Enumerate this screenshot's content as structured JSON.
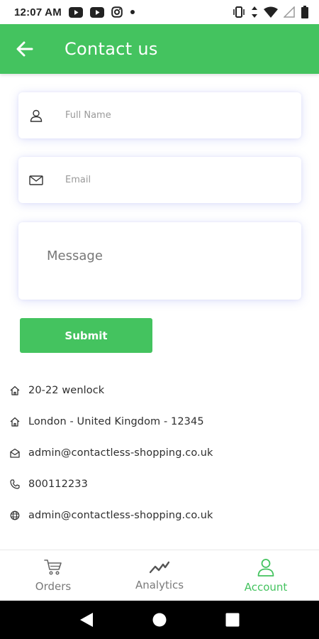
{
  "status_bar": {
    "time": "12:07 AM",
    "left_icons": [
      "youtube-icon",
      "youtube-icon",
      "instagram-icon",
      "dot-icon"
    ],
    "right_icons": [
      "vibrate-icon",
      "data-arrows-icon",
      "wifi-icon",
      "signal-icon",
      "battery-icon"
    ]
  },
  "header": {
    "title": "Contact us",
    "back_icon": "arrow-left-icon",
    "color": "#44c35f"
  },
  "form": {
    "full_name": {
      "placeholder": "Full Name",
      "value": "",
      "icon": "person-icon"
    },
    "email": {
      "placeholder": "Email",
      "value": "",
      "icon": "mail-icon"
    },
    "message": {
      "placeholder": "Message",
      "value": ""
    },
    "submit_label": "Submit"
  },
  "contact_info": {
    "address_line1": {
      "icon": "home-icon",
      "text": "20-22 wenlock"
    },
    "address_line2": {
      "icon": "home-icon",
      "text": "London - United Kingdom - 12345"
    },
    "email": {
      "icon": "mail-open-icon",
      "text": "admin@contactless-shopping.co.uk"
    },
    "phone": {
      "icon": "phone-icon",
      "text": "800112233"
    },
    "website": {
      "icon": "globe-icon",
      "text": "admin@contactless-shopping.co.uk"
    }
  },
  "bottom_nav": {
    "items": [
      {
        "label": "Orders",
        "icon": "cart-icon",
        "active": false
      },
      {
        "label": "Analytics",
        "icon": "trend-icon",
        "active": false
      },
      {
        "label": "Account",
        "icon": "person-icon",
        "active": true
      }
    ],
    "active_color": "#44c35f"
  },
  "system_nav": {
    "buttons": [
      "back-triangle-icon",
      "home-circle-icon",
      "recents-square-icon"
    ]
  }
}
